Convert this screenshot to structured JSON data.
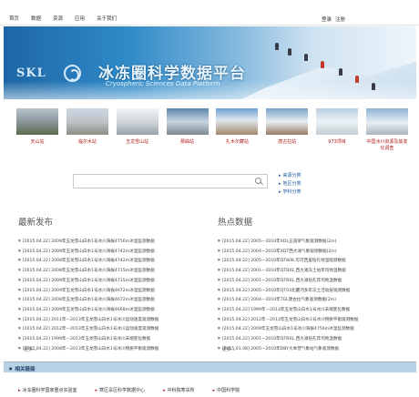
{
  "nav": {
    "items": [
      "首页",
      "数据",
      "资源",
      "应用",
      "关于我们"
    ],
    "login": "登录",
    "register": "注册"
  },
  "banner": {
    "logo_text": "SKL",
    "title_cn": "冰冻圈科学数据平台",
    "title_en": "Cryospheric Sciences Data Platform"
  },
  "stations": [
    {
      "label": "天山站"
    },
    {
      "label": "临尔木站"
    },
    {
      "label": "玉龙雪山站"
    },
    {
      "label": "那曲站"
    },
    {
      "label": "扎木尔藏站"
    },
    {
      "label": "唐古拉站"
    },
    {
      "label": "973项目"
    },
    {
      "label": "中国冰川资源及其变化调查"
    }
  ],
  "search": {
    "placeholder": ""
  },
  "categories": [
    "来源分类",
    "地区分类",
    "学科分类"
  ],
  "latest": {
    "title": "最新发布",
    "items": [
      "[2015.04.22] 2009年玉龙雪山白水1号冰川海拔4756m冰温监测数据",
      "[2015.04.22] 2009年玉龙雪山白水1号冰川海拔4742m冰温监测数据",
      "[2015.04.22] 2008年玉龙雪山白水1号冰川海拔4742m冰温监测数据",
      "[2015.04.22] 2008年玉龙雪山白水1号冰川海拔4715m冰温监测数据",
      "[2015.04.22] 2009年玉龙雪山白水1号冰川海拔4715m冰温监测数据",
      "[2015.04.22] 2009年玉龙雪山白水1号冰川海拔4672m冰温监测数据",
      "[2015.04.22] 2008年玉龙雪山白水1号冰川海拔4672m冰温监测数据",
      "[2015.04.22] 2009年玉龙雪山白水1号冰川海拔4668m冰温监测数据",
      "[2015.04.22] 2011年—2013年玉龙雪山白水1号冰川运动速度观测数据",
      "[2015.04.22] 2012年—2013年玉龙雪山白水1号冰川运动速度观测数据",
      "[2015.04.22] 1999年—2013年玉龙雪山白水1号冰川末端变化数据",
      "[2015.04.22] 2008年—2013年玉龙雪山白水1号冰川物质平衡观测数据"
    ],
    "more": "更多..."
  },
  "hot": {
    "title": "热点数据",
    "items": [
      "[2015.04.22] 2005—2010年XDL五道梁气象观测数据(2m)",
      "[2015.04.22] 2004—2010年XDT西大滩气象观测数据(2m)",
      "[2015.04.22] 2005—2010年QT806,可可西里钻孔地温观测数据",
      "[2015.04.22] 2001—2010年QTB01,西大滩冻土站年均地温数据",
      "[2015.04.22] 2001—2010年QTB01,西大滩钻孔年均地温数据",
      "[2015.04.22] 2005—2010年QT03北麓河多年冻土活动层观测数据",
      "[2015.04.22] 2004—2010年TGL唐古拉气象观测数据(2m)",
      "[2015.04.22] 1999年—2013年玉龙雪山白水1号冰川末端变化数据",
      "[2015.04.22] 2012年—2013年玉龙雪山白水1号冰川物质平衡观测数据",
      "[2015.04.22] 2009年玉龙雪山白水1号冰川海拔4756m冰温监测数据",
      "[2015.04.22] 2001—2010年QTB01,西大滩钻孔年均地温数据",
      "[2015.01.08] 2005—2010年DBY大本营气象站气象观测数据"
    ],
    "more": "更多..."
  },
  "related": {
    "title": "相关链接",
    "links": [
      "冰冻圈科学国家重点实验室",
      "寒区旱区科学数据中心",
      "中科院寒旱所",
      "中国科学院"
    ]
  },
  "colors": {
    "station_label": "#b01e1e",
    "category_link": "#1a56a0",
    "links_bar": "#b8d0e4"
  }
}
